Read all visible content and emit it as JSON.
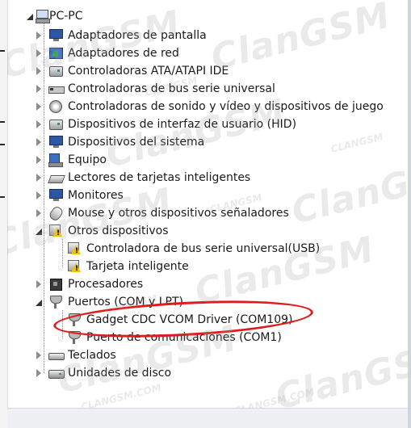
{
  "root": {
    "label": "PC-PC",
    "icon": "computer-icon"
  },
  "categories": [
    {
      "label": "Adaptadores de pantalla",
      "icon": "display-adapter-icon",
      "state": "collapsed"
    },
    {
      "label": "Adaptadores de red",
      "icon": "network-adapter-icon",
      "state": "collapsed"
    },
    {
      "label": "Controladoras ATA/ATAPI IDE",
      "icon": "ide-controller-icon",
      "state": "collapsed"
    },
    {
      "label": "Controladoras de bus serie universal",
      "icon": "usb-controller-icon",
      "state": "collapsed"
    },
    {
      "label": "Controladoras de sonido y vídeo y dispositivos de juego",
      "icon": "sound-icon",
      "state": "collapsed"
    },
    {
      "label": "Dispositivos de interfaz de usuario (HID)",
      "icon": "hid-icon",
      "state": "collapsed"
    },
    {
      "label": "Dispositivos del sistema",
      "icon": "system-devices-icon",
      "state": "collapsed"
    },
    {
      "label": "Equipo",
      "icon": "computer-icon",
      "state": "collapsed"
    },
    {
      "label": "Lectores de tarjetas inteligentes",
      "icon": "smart-card-reader-icon",
      "state": "collapsed"
    },
    {
      "label": "Monitores",
      "icon": "monitor-icon",
      "state": "collapsed"
    },
    {
      "label": "Mouse y otros dispositivos señaladores",
      "icon": "mouse-icon",
      "state": "collapsed"
    },
    {
      "label": "Otros dispositivos",
      "icon": "warning-device-icon",
      "state": "expanded",
      "children": [
        {
          "label": "Controladora de bus serie universal(USB)",
          "icon": "warning-device-icon"
        },
        {
          "label": "Tarjeta inteligente",
          "icon": "warning-device-icon"
        }
      ]
    },
    {
      "label": "Procesadores",
      "icon": "processor-icon",
      "state": "collapsed"
    },
    {
      "label": "Puertos (COM y LPT)",
      "icon": "port-icon",
      "state": "expanded",
      "children": [
        {
          "label": "Gadget CDC VCOM Driver (COM109)",
          "icon": "port-icon",
          "highlighted": true
        },
        {
          "label": "Puerto de comunicaciones (COM1)",
          "icon": "port-icon"
        }
      ]
    },
    {
      "label": "Teclados",
      "icon": "keyboard-icon",
      "state": "collapsed"
    },
    {
      "label": "Unidades de disco",
      "icon": "disk-drive-icon",
      "state": "collapsed"
    }
  ],
  "watermark": {
    "text": "ClanGSM",
    "small_text": "CLANGSM",
    "small_text_alt": "CLANGSM.COM"
  },
  "colors": {
    "highlight": "#e01b1b",
    "selection": "#2d57a6"
  }
}
